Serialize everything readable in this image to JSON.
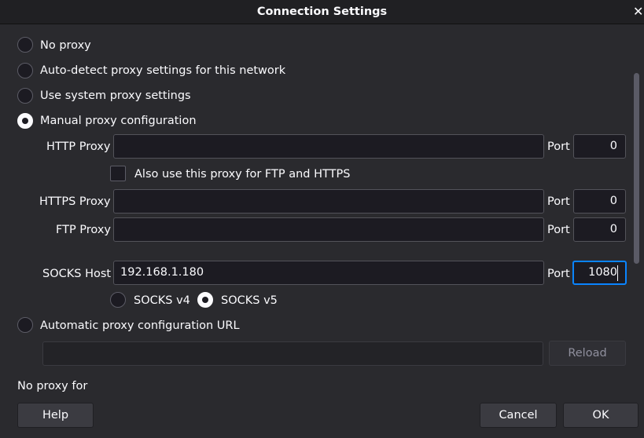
{
  "window": {
    "title": "Connection Settings",
    "close_glyph": "✕"
  },
  "proxy_modes": {
    "no_proxy": "No proxy",
    "auto_detect": "Auto-detect proxy settings for this network",
    "system": "Use system proxy settings",
    "manual": "Manual proxy configuration",
    "auto_url": "Automatic proxy configuration URL",
    "selected": "manual"
  },
  "manual": {
    "http_label": "HTTP Proxy",
    "http_value": "",
    "port_label": "Port",
    "http_port": "0",
    "also_use_label": "Also use this proxy for FTP and HTTPS",
    "also_use_checked": false,
    "https_label": "HTTPS Proxy",
    "https_value": "",
    "https_port": "0",
    "ftp_label": "FTP Proxy",
    "ftp_value": "",
    "ftp_port": "0",
    "socks_label": "SOCKS Host",
    "socks_value": "192.168.1.180",
    "socks_port": "1080",
    "socks_v4": "SOCKS v4",
    "socks_v5": "SOCKS v5",
    "socks_version_selected": "v5"
  },
  "auto_url": {
    "value": "",
    "reload": "Reload"
  },
  "no_proxy_for": "No proxy for",
  "buttons": {
    "help": "Help",
    "cancel": "Cancel",
    "ok": "OK"
  },
  "colors": {
    "accent": "#0a84ff",
    "background": "#2a2a2e",
    "field": "#1c1b22"
  }
}
